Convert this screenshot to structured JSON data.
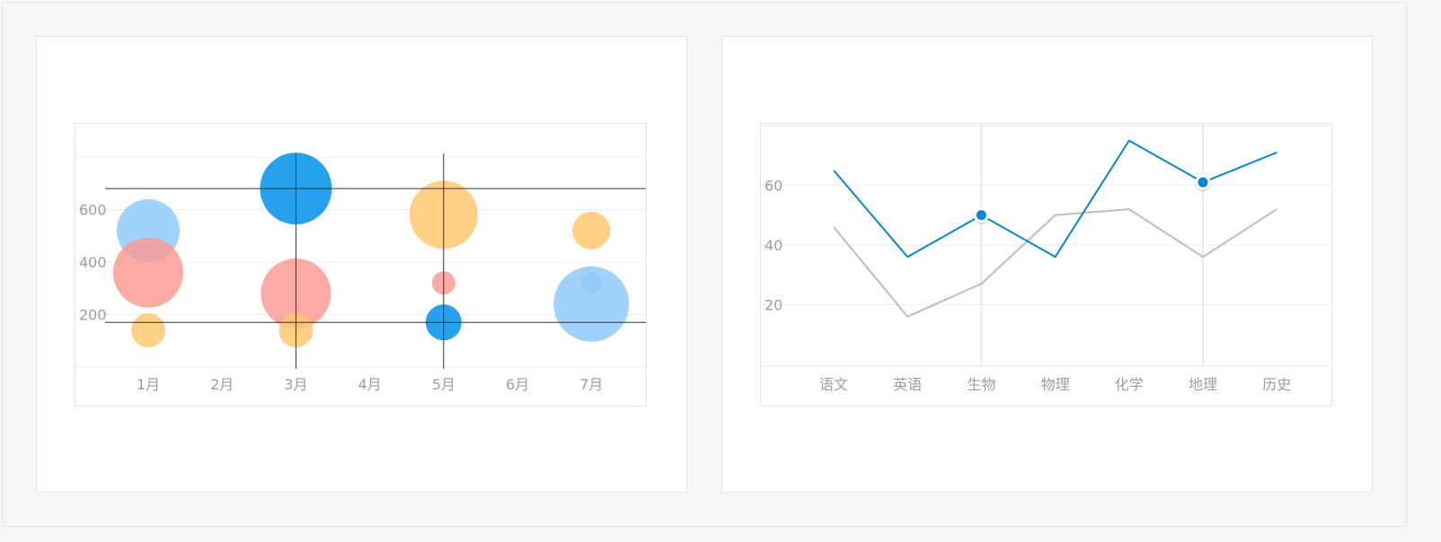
{
  "chart_data": [
    {
      "type": "scatter",
      "variant": "bubble",
      "categories": [
        "1月",
        "2月",
        "3月",
        "4月",
        "5月",
        "6月",
        "7月"
      ],
      "yticks": [
        "200",
        "400",
        "600"
      ],
      "ylim": [
        0,
        800
      ],
      "grid": true,
      "series": [
        {
          "color": "#90caf9",
          "points": [
            {
              "x": "1月",
              "y": 520,
              "size": 35
            },
            {
              "x": "7月",
              "y": 240,
              "size": 42
            },
            {
              "x": "7月",
              "y": 320,
              "size": 12
            }
          ]
        },
        {
          "color": "#fa9b95",
          "points": [
            {
              "x": "1月",
              "y": 360,
              "size": 39
            },
            {
              "x": "3月",
              "y": 280,
              "size": 39
            },
            {
              "x": "5月",
              "y": 320,
              "size": 13
            }
          ]
        },
        {
          "color": "#ffc870",
          "points": [
            {
              "x": "1月",
              "y": 140,
              "size": 19
            },
            {
              "x": "3月",
              "y": 140,
              "size": 19
            },
            {
              "x": "5月",
              "y": 580,
              "size": 38
            },
            {
              "x": "7月",
              "y": 520,
              "size": 21
            }
          ]
        },
        {
          "color": "#0091ea",
          "points": [
            {
              "x": "3月",
              "y": 680,
              "size": 40
            },
            {
              "x": "5月",
              "y": 170,
              "size": 20
            }
          ]
        }
      ],
      "crosshair": {
        "x": [
          "3月",
          "5月"
        ],
        "y": [
          680,
          170
        ]
      }
    },
    {
      "type": "line",
      "categories": [
        "语文",
        "英语",
        "生物",
        "物理",
        "化学",
        "地理",
        "历史"
      ],
      "yticks": [
        "20",
        "40",
        "60"
      ],
      "ylim": [
        0,
        80
      ],
      "grid": true,
      "series": [
        {
          "color": "#0288d1",
          "values": [
            65,
            36,
            50,
            36,
            75,
            61,
            71
          ]
        },
        {
          "color": "#bdbdbd",
          "values": [
            46,
            16,
            27,
            50,
            52,
            36,
            52
          ]
        }
      ],
      "highlighted_points": [
        {
          "series": 0,
          "x": "生物"
        },
        {
          "series": 0,
          "x": "地理"
        }
      ],
      "vertical_guides": [
        "生物",
        "地理"
      ]
    }
  ]
}
